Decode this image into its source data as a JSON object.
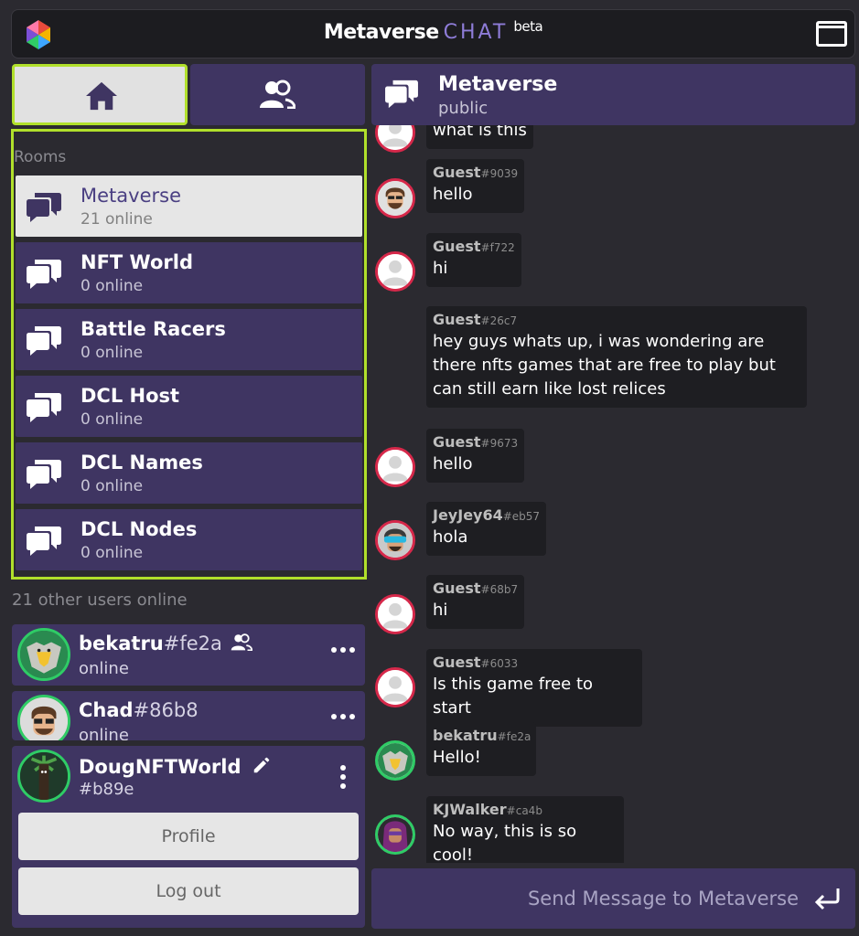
{
  "app": {
    "title_main": "Metaverse",
    "title_chat": "CHAT",
    "title_beta": "beta"
  },
  "tabs": [
    {
      "name": "home",
      "icon": "home-icon"
    },
    {
      "name": "friends",
      "icon": "users-icon"
    }
  ],
  "rooms_label": "Rooms",
  "rooms": [
    {
      "name": "Metaverse",
      "count": "21 online",
      "active": true
    },
    {
      "name": "NFT World",
      "count": "0 online"
    },
    {
      "name": "Battle Racers",
      "count": "0 online"
    },
    {
      "name": "DCL Host",
      "count": "0 online"
    },
    {
      "name": "DCL Names",
      "count": "0 online"
    },
    {
      "name": "DCL Nodes",
      "count": "0 online"
    }
  ],
  "users_label": "21 other users online",
  "users": [
    {
      "name": "bekatru",
      "tag": "#fe2a",
      "status": "online",
      "friend": true
    },
    {
      "name": "Chad",
      "tag": "#86b8",
      "status": "online"
    }
  ],
  "me": {
    "name": "DougNFTWorld",
    "tag": "#b89e",
    "profile_label": "Profile",
    "logout_label": "Log out"
  },
  "chat": {
    "title": "Metaverse",
    "subtitle": "public"
  },
  "messages": [
    {
      "who": "",
      "tag": "",
      "text": "what is this"
    },
    {
      "who": "Guest",
      "tag": "#9039",
      "text": "hello"
    },
    {
      "who": "Guest",
      "tag": "#f722",
      "text": "hi"
    },
    {
      "who": "Guest",
      "tag": "#26c7",
      "text": "hey guys whats up, i was wondering are there nfts games that are free to play but can still earn like lost relices"
    },
    {
      "who": "Guest",
      "tag": "#9673",
      "text": "hello"
    },
    {
      "who": "JeyJey64",
      "tag": "#eb57",
      "text": "hola"
    },
    {
      "who": "Guest",
      "tag": "#68b7",
      "text": "hi"
    },
    {
      "who": "Guest",
      "tag": "#6033",
      "text": "Is this game free to start"
    },
    {
      "who": "bekatru",
      "tag": "#fe2a",
      "text": "Hello!"
    },
    {
      "who": "KJWalker",
      "tag": "#ca4b",
      "text": "No way, this is so cool!"
    }
  ],
  "send": {
    "placeholder": "Send Message to Metaverse"
  },
  "colors": {
    "panel": "#3f3562",
    "highlight": "#b1e02b",
    "online": "#2fcc66",
    "guest_ring": "#d6284a",
    "accent": "#8e7cd8"
  }
}
